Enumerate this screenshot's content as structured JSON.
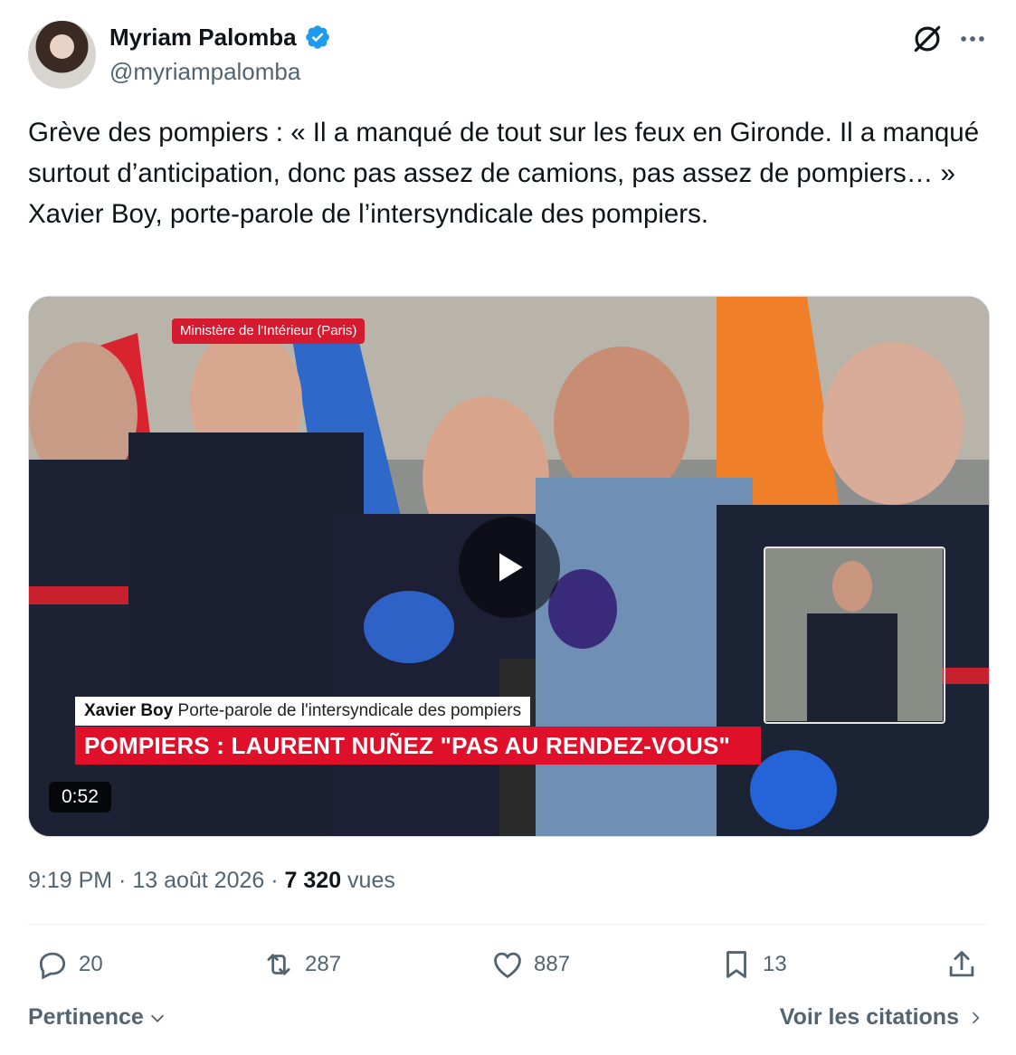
{
  "author": {
    "name": "Myriam Palomba",
    "handle": "@myriampalomba"
  },
  "icons": [
    "verified-badge-icon",
    "grok-icon",
    "more-icon",
    "play-icon",
    "reply-icon",
    "repost-icon",
    "like-icon",
    "bookmark-icon",
    "share-icon",
    "chevron-down-icon",
    "chevron-right-icon"
  ],
  "colors": {
    "verified": "#1d9bf0",
    "text": "#0f1419",
    "secondary": "#536471",
    "news_red": "#e1102a"
  },
  "tweet": {
    "text": "Grève des pompiers : « Il a manqué de tout sur les feux en Gironde. Il a manqué surtout d’anticipation, donc pas assez de camions, pas assez de pompiers… » Xavier Boy, porte-parole de l’intersyndicale des pompiers."
  },
  "video": {
    "location_tag": "Ministère de l'Intérieur (Paris)",
    "caption_name": "Xavier Boy",
    "caption_role": "Porte-parole de l'intersyndicale des pompiers",
    "headline": "POMPIERS : LAURENT NUÑEZ \"PAS AU RENDEZ-VOUS\"",
    "duration": "0:52"
  },
  "meta": {
    "time": "9:19 PM",
    "date": "13 août 2026",
    "views_count": "7 320",
    "views_label": "vues"
  },
  "actions": {
    "replies": "20",
    "reposts": "287",
    "likes": "887",
    "bookmarks": "13"
  },
  "footer": {
    "sort_label": "Pertinence",
    "quotes_label": "Voir les citations"
  }
}
